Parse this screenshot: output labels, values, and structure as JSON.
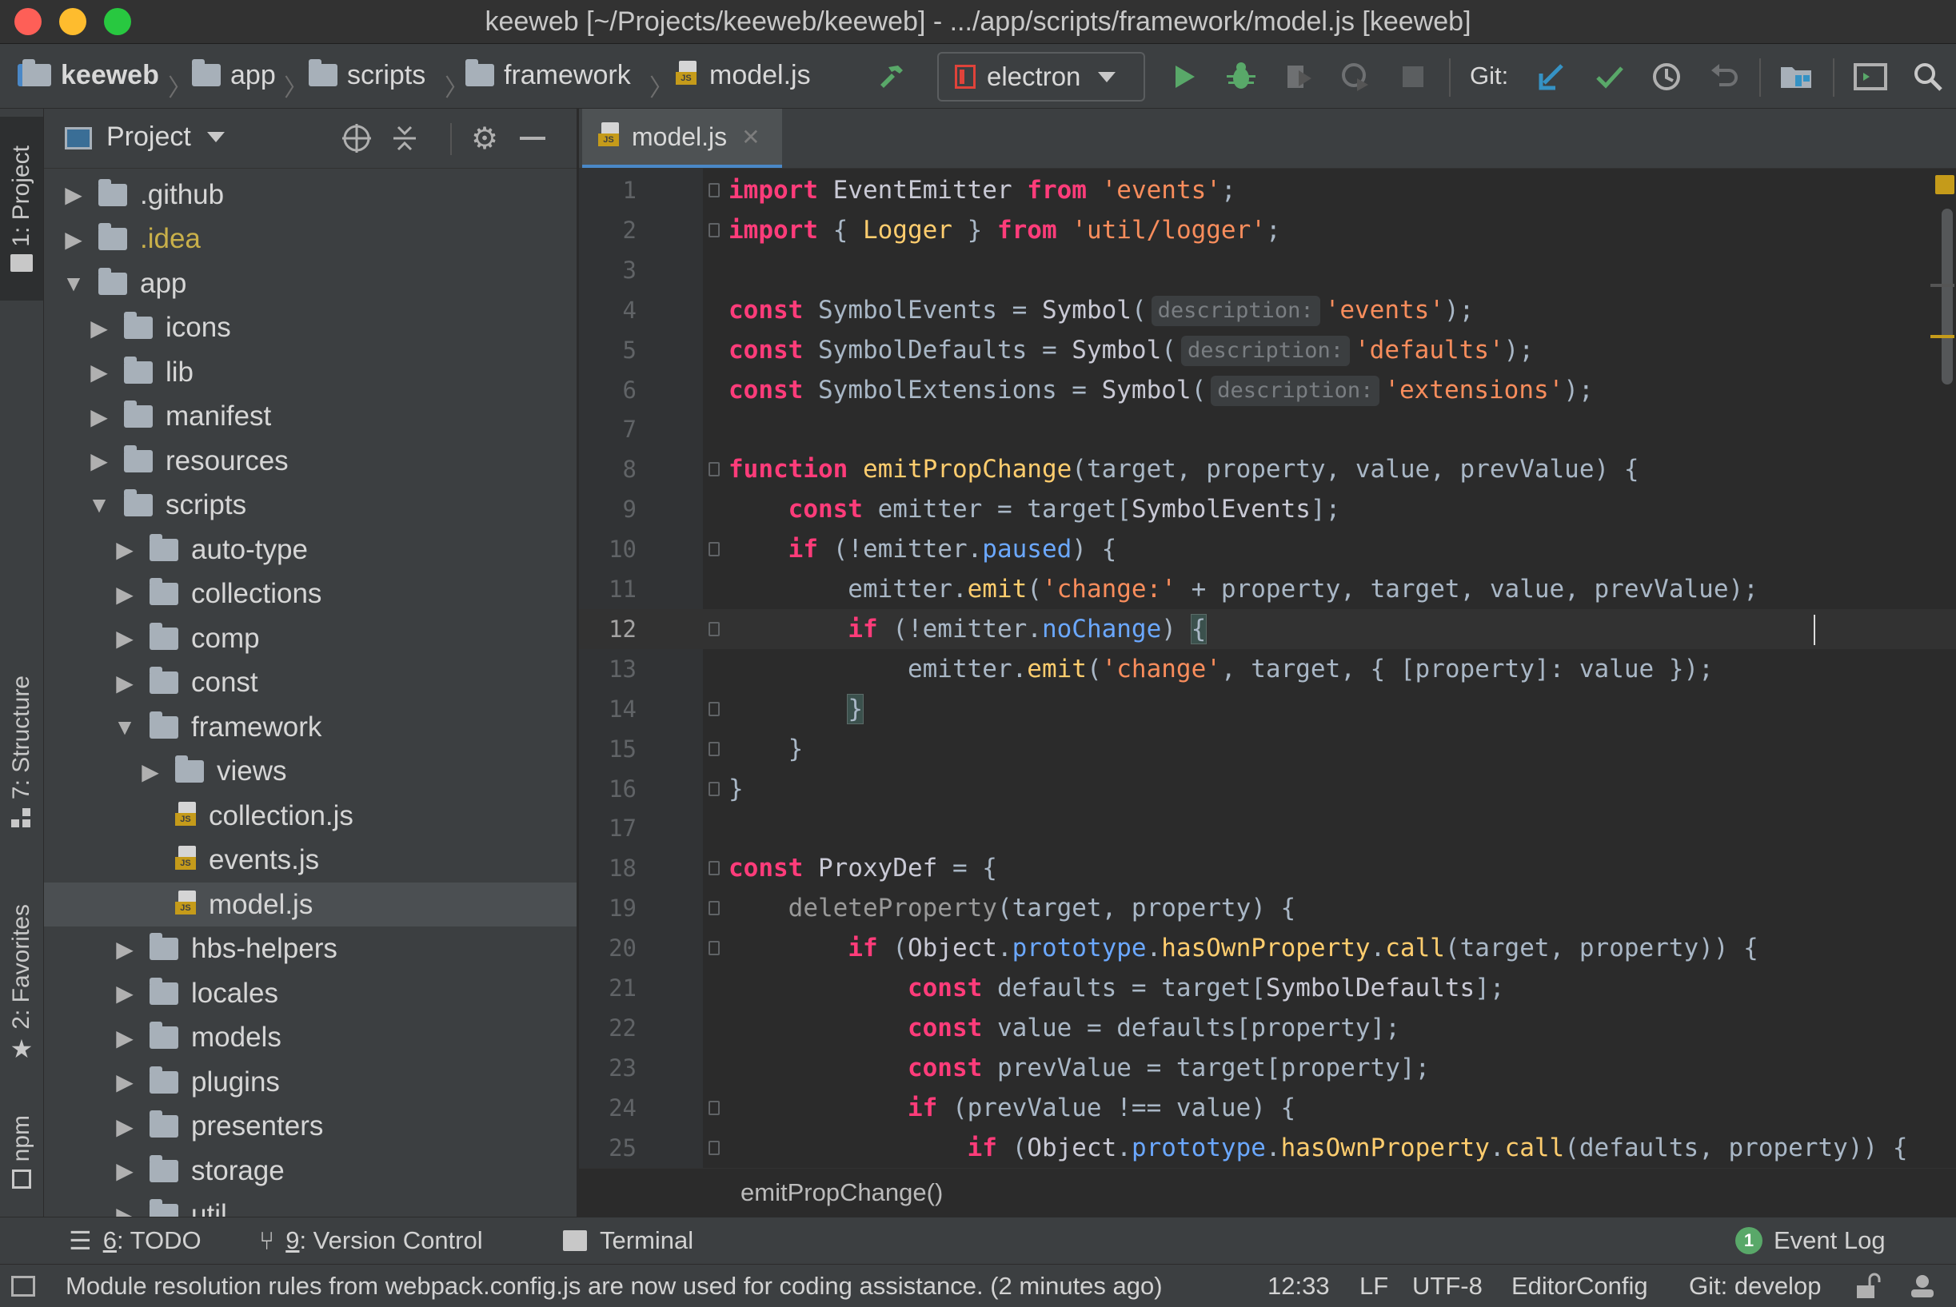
{
  "window": {
    "title": "keeweb [~/Projects/keeweb/keeweb] - .../app/scripts/framework/model.js [keeweb]"
  },
  "navbar": {
    "breadcrumbs": [
      "keeweb",
      "app",
      "scripts",
      "framework",
      "model.js"
    ],
    "run_config": "electron",
    "git_label": "Git:",
    "icons": [
      "build-hammer-icon",
      "run-icon",
      "debug-icon",
      "coverage-icon",
      "profile-icon",
      "stop-icon",
      "git-update-icon",
      "git-commit-icon",
      "git-history-icon",
      "git-rollback-icon",
      "project-structure-icon",
      "terminal-window-icon",
      "search-everywhere-icon"
    ]
  },
  "left_stripe": {
    "tabs": [
      "1: Project",
      "7: Structure",
      "2: Favorites",
      "npm"
    ]
  },
  "project_panel": {
    "title": "Project",
    "tree": [
      {
        "label": ".github",
        "kind": "folder",
        "depth": 0,
        "expanded": false
      },
      {
        "label": ".idea",
        "kind": "folder",
        "depth": 0,
        "expanded": false,
        "color": "#c9b04a"
      },
      {
        "label": "app",
        "kind": "folder",
        "depth": 0,
        "expanded": true
      },
      {
        "label": "icons",
        "kind": "folder",
        "depth": 1,
        "expanded": false
      },
      {
        "label": "lib",
        "kind": "folder",
        "depth": 1,
        "expanded": false
      },
      {
        "label": "manifest",
        "kind": "folder",
        "depth": 1,
        "expanded": false
      },
      {
        "label": "resources",
        "kind": "folder",
        "depth": 1,
        "expanded": false
      },
      {
        "label": "scripts",
        "kind": "folder",
        "depth": 1,
        "expanded": true
      },
      {
        "label": "auto-type",
        "kind": "folder",
        "depth": 2,
        "expanded": false
      },
      {
        "label": "collections",
        "kind": "folder",
        "depth": 2,
        "expanded": false
      },
      {
        "label": "comp",
        "kind": "folder",
        "depth": 2,
        "expanded": false
      },
      {
        "label": "const",
        "kind": "folder",
        "depth": 2,
        "expanded": false
      },
      {
        "label": "framework",
        "kind": "folder",
        "depth": 2,
        "expanded": true
      },
      {
        "label": "views",
        "kind": "folder",
        "depth": 3,
        "expanded": false
      },
      {
        "label": "collection.js",
        "kind": "js",
        "depth": 3
      },
      {
        "label": "events.js",
        "kind": "js",
        "depth": 3
      },
      {
        "label": "model.js",
        "kind": "js",
        "depth": 3,
        "selected": true
      },
      {
        "label": "hbs-helpers",
        "kind": "folder",
        "depth": 2,
        "expanded": false
      },
      {
        "label": "locales",
        "kind": "folder",
        "depth": 2,
        "expanded": false
      },
      {
        "label": "models",
        "kind": "folder",
        "depth": 2,
        "expanded": false
      },
      {
        "label": "plugins",
        "kind": "folder",
        "depth": 2,
        "expanded": false
      },
      {
        "label": "presenters",
        "kind": "folder",
        "depth": 2,
        "expanded": false
      },
      {
        "label": "storage",
        "kind": "folder",
        "depth": 2,
        "expanded": false
      },
      {
        "label": "util",
        "kind": "folder",
        "depth": 2,
        "expanded": false
      }
    ]
  },
  "editor": {
    "tab_label": "model.js",
    "current_line": 12,
    "lines": [
      [
        [
          "import",
          "k"
        ],
        [
          " ",
          ""
        ],
        [
          "EventEmitter",
          "p"
        ],
        [
          " ",
          ""
        ],
        [
          "from",
          "k"
        ],
        [
          " ",
          ""
        ],
        [
          "'events'",
          "s"
        ],
        [
          ";",
          ""
        ]
      ],
      [
        [
          "import",
          "k"
        ],
        [
          " { ",
          ""
        ],
        [
          "Logger",
          "c"
        ],
        [
          " } ",
          ""
        ],
        [
          "from",
          "k"
        ],
        [
          " ",
          ""
        ],
        [
          "'util/logger'",
          "s"
        ],
        [
          ";",
          ""
        ]
      ],
      [],
      [
        [
          "const",
          "k"
        ],
        [
          " SymbolEvents = ",
          ""
        ],
        [
          "Symbol",
          "p"
        ],
        [
          "(",
          ""
        ],
        [
          "description:",
          "hint"
        ],
        [
          "'events'",
          "s"
        ],
        [
          ");",
          ""
        ]
      ],
      [
        [
          "const",
          "k"
        ],
        [
          " SymbolDefaults = ",
          ""
        ],
        [
          "Symbol",
          "p"
        ],
        [
          "(",
          ""
        ],
        [
          "description:",
          "hint"
        ],
        [
          "'defaults'",
          "s"
        ],
        [
          ");",
          ""
        ]
      ],
      [
        [
          "const",
          "k"
        ],
        [
          " SymbolExtensions = ",
          ""
        ],
        [
          "Symbol",
          "p"
        ],
        [
          "(",
          ""
        ],
        [
          "description:",
          "hint"
        ],
        [
          "'extensions'",
          "s"
        ],
        [
          ");",
          ""
        ]
      ],
      [],
      [
        [
          "function",
          "k"
        ],
        [
          " ",
          ""
        ],
        [
          "emitPropChange",
          "c"
        ],
        [
          "(target, property, value, prevValue) {",
          ""
        ]
      ],
      [
        [
          "    ",
          ""
        ],
        [
          "const",
          "k"
        ],
        [
          " emitter = target[",
          ""
        ],
        [
          "SymbolEvents",
          "p"
        ],
        [
          "];",
          ""
        ]
      ],
      [
        [
          "    ",
          ""
        ],
        [
          "if",
          "k"
        ],
        [
          " (!emitter.",
          ""
        ],
        [
          "paused",
          "f"
        ],
        [
          ") {",
          ""
        ]
      ],
      [
        [
          "        emitter.",
          ""
        ],
        [
          "emit",
          "c"
        ],
        [
          "(",
          ""
        ],
        [
          "'change:'",
          "s"
        ],
        [
          " + property, target, value, prevValue);",
          ""
        ]
      ],
      [
        [
          "        ",
          ""
        ],
        [
          "if",
          "k"
        ],
        [
          " (!emitter.",
          ""
        ],
        [
          "noChange",
          "f"
        ],
        [
          ") ",
          ""
        ],
        [
          "{",
          "bracematch"
        ]
      ],
      [
        [
          "            emitter.",
          ""
        ],
        [
          "emit",
          "c"
        ],
        [
          "(",
          ""
        ],
        [
          "'change'",
          "s"
        ],
        [
          ", target, { [property]: value });",
          ""
        ]
      ],
      [
        [
          "        ",
          ""
        ],
        [
          "}",
          "bracematch"
        ]
      ],
      [
        [
          "    }",
          ""
        ]
      ],
      [
        [
          "}",
          ""
        ]
      ],
      [],
      [
        [
          "const",
          "k"
        ],
        [
          " ",
          ""
        ],
        [
          "ProxyDef",
          "p"
        ],
        [
          " = {",
          ""
        ]
      ],
      [
        [
          "    ",
          ""
        ],
        [
          "deleteProperty",
          "g"
        ],
        [
          "(target, property) {",
          ""
        ]
      ],
      [
        [
          "        ",
          ""
        ],
        [
          "if",
          "k"
        ],
        [
          " (",
          ""
        ],
        [
          "Object",
          "p"
        ],
        [
          ".",
          ""
        ],
        [
          "prototype",
          "f"
        ],
        [
          ".",
          ""
        ],
        [
          "hasOwnProperty",
          "c"
        ],
        [
          ".",
          ""
        ],
        [
          "call",
          "c"
        ],
        [
          "(target, property)) {",
          ""
        ]
      ],
      [
        [
          "            ",
          ""
        ],
        [
          "const",
          "k"
        ],
        [
          " defaults = target[",
          ""
        ],
        [
          "SymbolDefaults",
          "p"
        ],
        [
          "];",
          ""
        ]
      ],
      [
        [
          "            ",
          ""
        ],
        [
          "const",
          "k"
        ],
        [
          " value = defaults[property];",
          ""
        ]
      ],
      [
        [
          "            ",
          ""
        ],
        [
          "const",
          "k"
        ],
        [
          " prevValue = target[property];",
          ""
        ]
      ],
      [
        [
          "            ",
          ""
        ],
        [
          "if",
          "k"
        ],
        [
          " (prevValue !== value) {",
          ""
        ]
      ],
      [
        [
          "                ",
          ""
        ],
        [
          "if",
          "k"
        ],
        [
          " (",
          ""
        ],
        [
          "Object",
          "p"
        ],
        [
          ".",
          ""
        ],
        [
          "prototype",
          "f"
        ],
        [
          ".",
          ""
        ],
        [
          "hasOwnProperty",
          "c"
        ],
        [
          ".",
          ""
        ],
        [
          "call",
          "c"
        ],
        [
          "(defaults, property)) {",
          ""
        ]
      ]
    ],
    "fold_lines": [
      1,
      2,
      8,
      10,
      12,
      14,
      15,
      16,
      18,
      19,
      20,
      24,
      25
    ],
    "breadcrumb": "emitPropChange()"
  },
  "bottom_bar": {
    "todo_num": "6",
    "todo": ": TODO",
    "vcs_num": "9",
    "vcs": ": Version Control",
    "terminal": "Terminal",
    "event_log_count": "1",
    "event_log": "Event Log"
  },
  "status_bar": {
    "message": "Module resolution rules from webpack.config.js are now used for coding assistance. (2 minutes ago)",
    "position": "12:33",
    "line_separator": "LF",
    "encoding": "UTF-8",
    "code_style": "EditorConfig",
    "git_branch": "Git: develop"
  },
  "colors": {
    "keyword": "#ff3c7a",
    "string": "#f98d5c",
    "function_call": "#ffcd6e",
    "property": "#6ba8ff",
    "run_green": "#59a869",
    "git_blue": "#3592c4",
    "accent": "#4a88c7"
  }
}
